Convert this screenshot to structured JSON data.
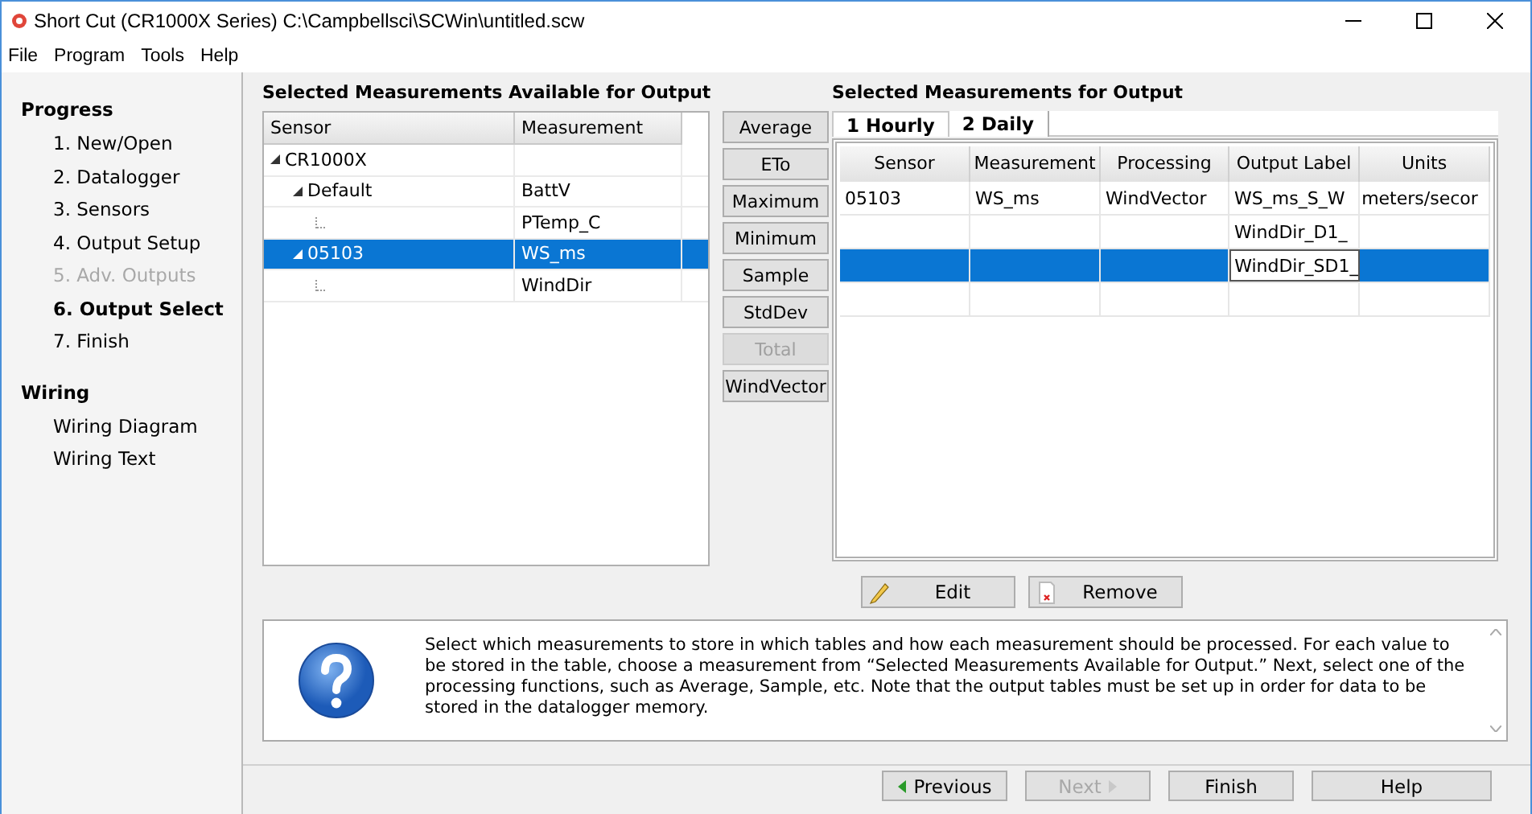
{
  "window": {
    "title": "Short Cut (CR1000X Series) C:\\Campbellsci\\SCWin\\untitled.scw"
  },
  "menu": [
    "File",
    "Program",
    "Tools",
    "Help"
  ],
  "sidebar": {
    "sections": [
      {
        "title": "Progress",
        "items": [
          {
            "label": "1. New/Open",
            "selected": false,
            "disabled": false
          },
          {
            "label": "2. Datalogger",
            "selected": false,
            "disabled": false
          },
          {
            "label": "3. Sensors",
            "selected": false,
            "disabled": false
          },
          {
            "label": "4. Output Setup",
            "selected": false,
            "disabled": false
          },
          {
            "label": "5. Adv. Outputs",
            "selected": false,
            "disabled": true
          },
          {
            "label": "6. Output Select",
            "selected": true,
            "disabled": false
          },
          {
            "label": "7. Finish",
            "selected": false,
            "disabled": false
          }
        ]
      },
      {
        "title": "Wiring",
        "items": [
          {
            "label": "Wiring Diagram",
            "selected": false,
            "disabled": false
          },
          {
            "label": "Wiring Text",
            "selected": false,
            "disabled": false
          }
        ]
      }
    ]
  },
  "available": {
    "title": "Selected Measurements Available for Output",
    "columns": [
      "Sensor",
      "Measurement"
    ],
    "tree": [
      {
        "sensor": "CR1000X",
        "selected": false,
        "expanded": true,
        "children": [
          {
            "sensor": "Default",
            "measurement": "BattV",
            "selected": false,
            "expanded": true,
            "children": [
              {
                "measurement": "PTemp_C",
                "selected": false
              }
            ]
          },
          {
            "sensor": "05103",
            "measurement": "WS_ms",
            "selected": true,
            "expanded": true,
            "children": [
              {
                "measurement": "WindDir",
                "selected": false
              }
            ]
          }
        ]
      }
    ]
  },
  "functions": [
    {
      "label": "Average",
      "disabled": false
    },
    {
      "label": "ETo",
      "disabled": false
    },
    {
      "label": "Maximum",
      "disabled": false
    },
    {
      "label": "Minimum",
      "disabled": false
    },
    {
      "label": "Sample",
      "disabled": false
    },
    {
      "label": "StdDev",
      "disabled": false
    },
    {
      "label": "Total",
      "disabled": true
    },
    {
      "label": "WindVector",
      "disabled": false
    }
  ],
  "output": {
    "title": "Selected Measurements for Output",
    "tabs": [
      {
        "label": "1 Hourly",
        "selected": true
      },
      {
        "label": "2 Daily",
        "selected": false
      }
    ],
    "columns": [
      "Sensor",
      "Measurement",
      "Processing",
      "Output Label",
      "Units"
    ],
    "rows": [
      {
        "cells": [
          "05103",
          "WS_ms",
          "WindVector",
          "WS_ms_S_W",
          "meters/secor"
        ],
        "selected": false,
        "editing": false
      },
      {
        "cells": [
          "",
          "",
          "",
          "WindDir_D1_",
          ""
        ],
        "selected": false,
        "editing": false
      },
      {
        "cells": [
          "",
          "",
          "",
          "WindDir_SD1_",
          ""
        ],
        "selected": true,
        "editing": true
      }
    ]
  },
  "table_actions": [
    "Edit",
    "Remove"
  ],
  "help_text": "Select which measurements to store in which tables and how each measurement should be processed. For each value to be stored in the table, choose a measurement from “Selected Measurements Available for Output.”  Next, select one of the processing functions, such as Average, Sample, etc. Note that the output tables must be set up in order for data to be stored in the datalogger memory.",
  "nav": [
    {
      "label": "Previous",
      "kind": "back",
      "disabled": false
    },
    {
      "label": "Next",
      "kind": "forward",
      "disabled": true
    },
    {
      "label": "Finish",
      "kind": "plain",
      "disabled": false
    },
    {
      "label": "Help",
      "kind": "plain",
      "disabled": false
    }
  ]
}
